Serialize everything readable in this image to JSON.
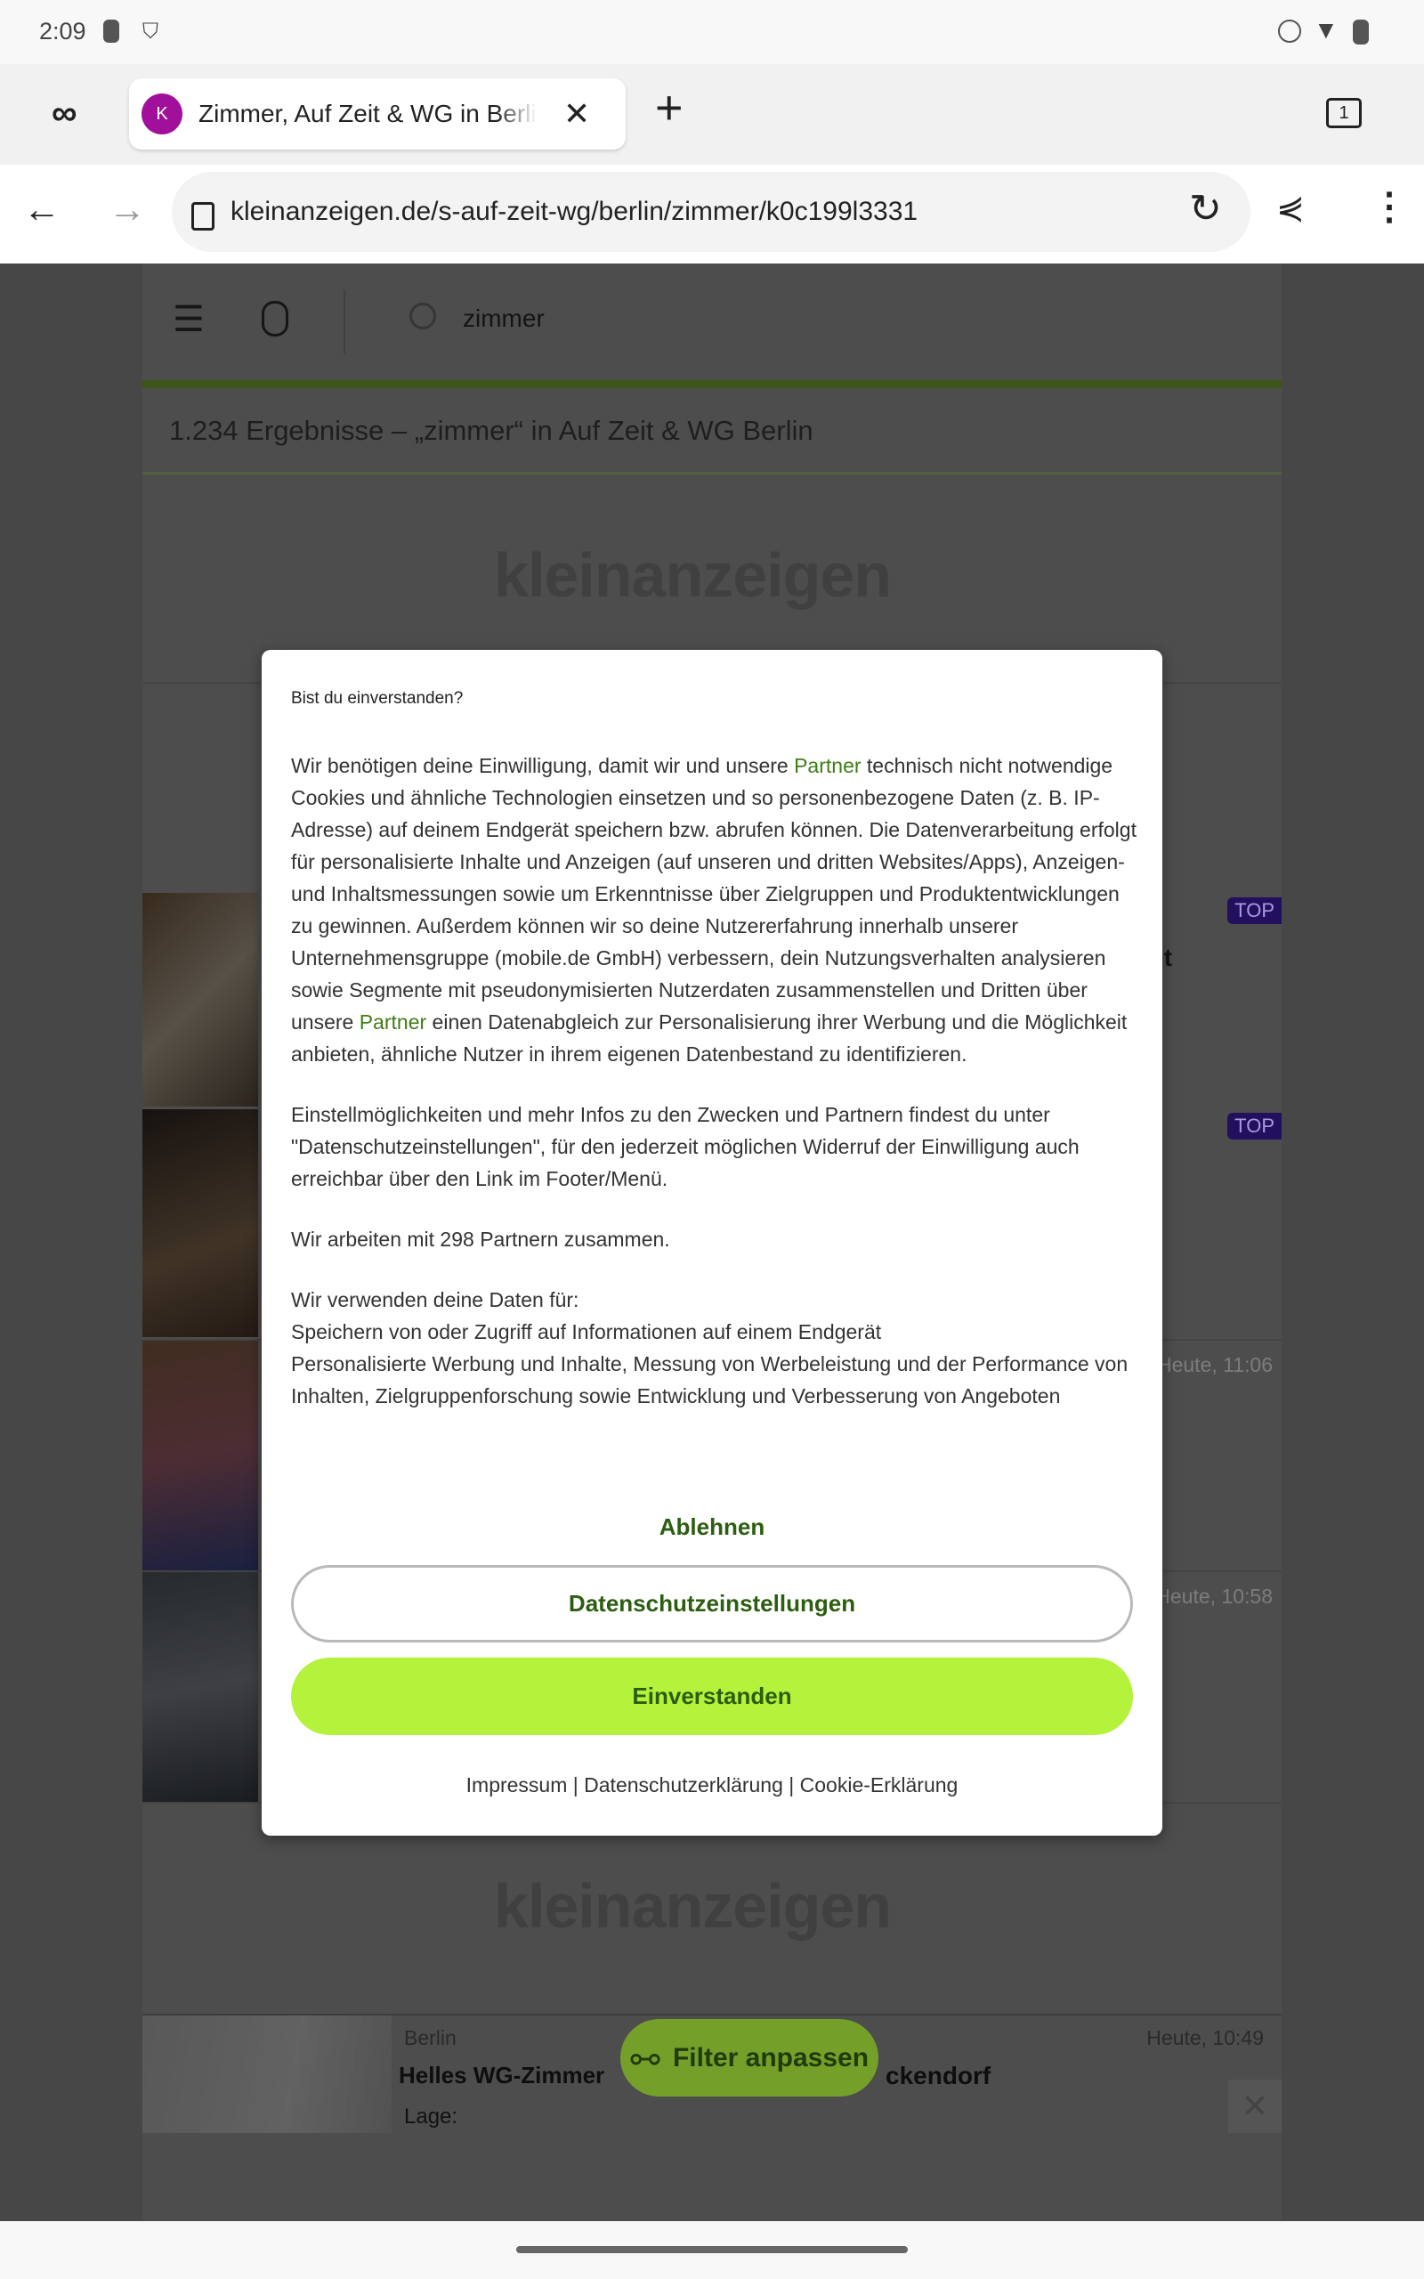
{
  "status_bar": {
    "time": "2:09",
    "left_icons": [
      "hand-icon",
      "vpn-shield-icon"
    ],
    "right_icons": [
      "dnd-icon",
      "wifi-icon",
      "hand-icon"
    ]
  },
  "browser": {
    "incognito_icon": "incognito-icon",
    "tab": {
      "favicon_letter": "K",
      "title": "Zimmer, Auf Zeit & WG in Berlin"
    },
    "tab_count": "1",
    "url": "kleinanzeigen.de/s-auf-zeit-wg/berlin/zimmer/k0c199l3331"
  },
  "site": {
    "search_value": "zimmer",
    "results_heading": "1.234 Ergebnisse – „zimmer“ in Auf Zeit & WG Berlin",
    "logo_text": "kleinanzeigen",
    "top_badge": "TOP",
    "fragments": {
      "title_tail": "it",
      "time1": "Heute, 11:06",
      "time2": "Heute, 10:58"
    },
    "bottom_listing": {
      "location": "Berlin",
      "time": "Heute, 10:49",
      "title_start": "Helles WG-Zimmer",
      "title_end": "ckendorf",
      "label": "Lage:"
    },
    "filter_button": "Filter anpassen",
    "accent_color": "#b4f23b"
  },
  "dialog": {
    "title": "Bist du einverstanden?",
    "p1_a": "Wir benötigen deine Einwilligung, damit wir und unsere ",
    "partner_link": "Partner",
    "p1_b": " technisch nicht notwendige Cookies und ähnliche Technologien einsetzen und so personenbezogene Daten (z. B. IP-Adresse) auf deinem Endgerät speichern bzw. abrufen können. Die Datenverarbeitung erfolgt für personalisierte Inhalte und Anzeigen (auf unseren und dritten Websites/Apps), Anzeigen- und Inhaltsmessungen sowie um Erkenntnisse über Zielgruppen und Produktentwicklungen zu gewinnen. Außerdem können wir so deine Nutzererfahrung innerhalb unserer Unternehmensgruppe (mobile.de GmbH) verbessern, dein Nutzungsverhalten analysieren sowie Segmente mit pseudonymisierten Nutzerdaten zusammenstellen und Dritten über unsere ",
    "p1_c": " einen Datenabgleich zur Personalisierung ihrer Werbung und die Möglichkeit anbieten, ähnliche Nutzer in ihrem eigenen Datenbestand zu identifizieren.",
    "p2": "Einstellmöglichkeiten und mehr Infos zu den Zwecken und Partnern findest du unter \"Datenschutzeinstellungen\", für den jederzeit möglichen Widerruf der Einwilligung auch erreichbar über den Link im Footer/Menü.",
    "p3": "Wir arbeiten mit 298 Partnern zusammen.",
    "p4_heading": "Wir verwenden deine Daten für:",
    "p4_line1": "Speichern von oder Zugriff auf Informationen auf einem Endgerät",
    "p4_line2": "Personalisierte Werbung und Inhalte, Messung von Werbeleistung und der Performance von Inhalten, Zielgruppenforschung sowie Entwicklung und Verbesserung von Angeboten",
    "decline": "Ablehnen",
    "settings": "Datenschutzeinstellungen",
    "accept": "Einverstanden",
    "links": {
      "imprint": "Impressum",
      "privacy": "Datenschutzerklärung",
      "cookie": "Cookie-Erklärung",
      "separator": " | "
    }
  }
}
